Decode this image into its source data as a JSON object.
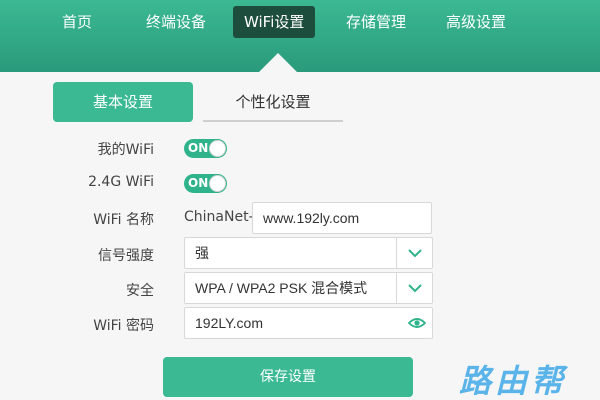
{
  "nav": {
    "items": [
      "首页",
      "终端设备",
      "WiFi设置",
      "存储管理",
      "高级设置"
    ],
    "active_index": 2
  },
  "tabs": {
    "basic": "基本设置",
    "personal": "个性化设置"
  },
  "form": {
    "wifi_label": "我的WiFi",
    "wifi_toggle": "ON",
    "band_label": "2.4G WiFi",
    "band_toggle": "ON",
    "name_label": "WiFi 名称",
    "name_prefix": "ChinaNet-",
    "name_value": "www.192ly.com",
    "signal_label": "信号强度",
    "signal_value": "强",
    "security_label": "安全",
    "security_value": "WPA / WPA2 PSK 混合模式",
    "password_label": "WiFi 密码",
    "password_value": "192LY.com"
  },
  "save_label": "保存设置",
  "watermark": "路由帮",
  "colors": {
    "accent": "#3bb993",
    "nav_active": "#1d4d3c",
    "watermark": "#5ab4ea"
  },
  "icons": {
    "dropdown": "chevron-down-icon",
    "password": "eye-icon"
  }
}
